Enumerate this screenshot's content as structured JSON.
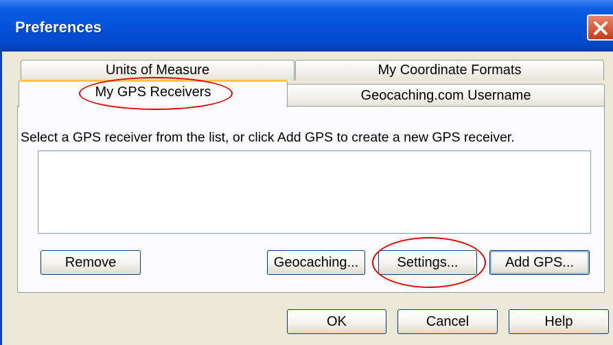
{
  "window": {
    "title": "Preferences"
  },
  "tabs": {
    "units": "Units of Measure",
    "coordinates": "My Coordinate Formats",
    "gps": "My GPS Receivers",
    "username": "Geocaching.com Username"
  },
  "panel": {
    "instruction": "Select a GPS receiver from the list, or click Add GPS to create a new GPS receiver.",
    "receivers": []
  },
  "buttons": {
    "remove": "Remove",
    "geocaching": "Geocaching...",
    "settings": "Settings...",
    "add_gps": "Add GPS...",
    "ok": "OK",
    "cancel": "Cancel",
    "help": "Help"
  },
  "colors": {
    "titlebar": "#0552dc",
    "highlight": "#e00000",
    "active_tab_accent": "#fdc54a"
  }
}
